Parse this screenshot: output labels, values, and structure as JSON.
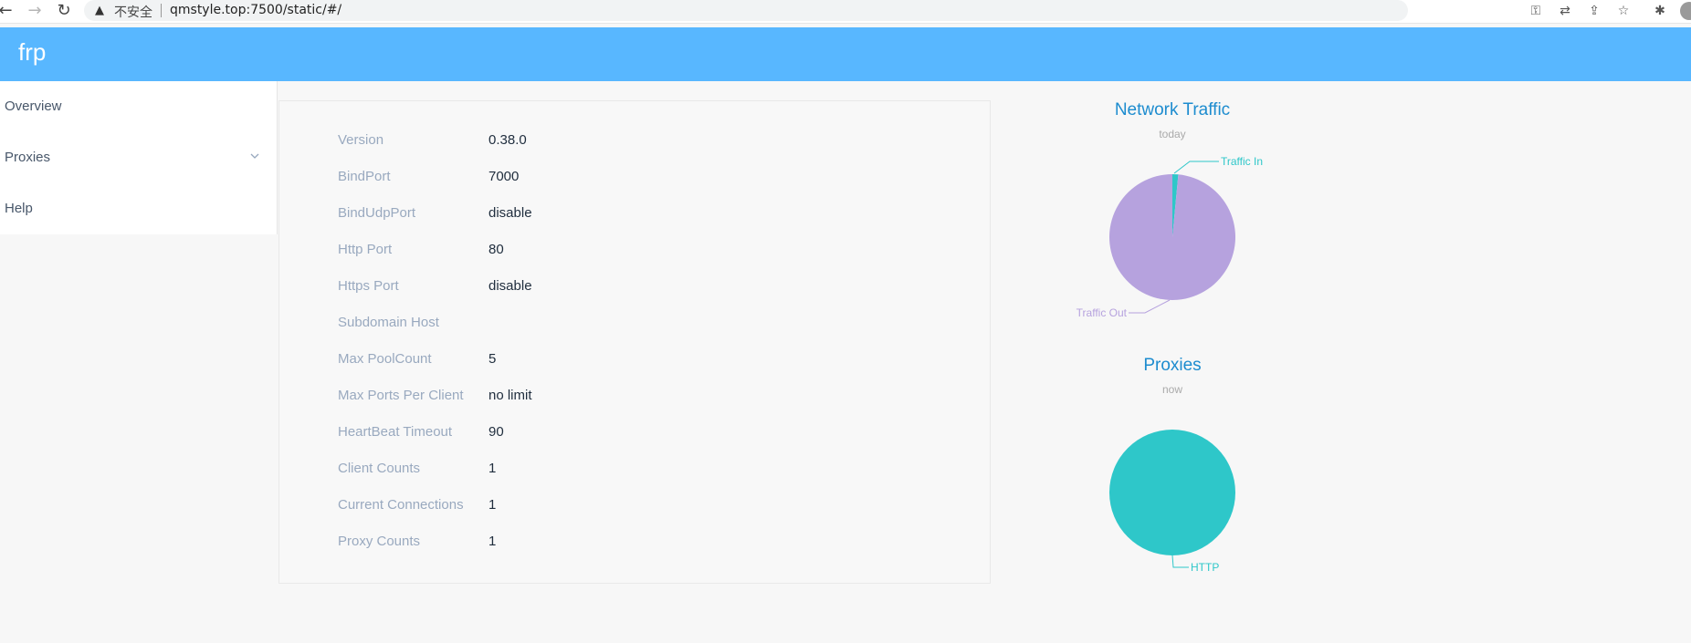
{
  "browser": {
    "back_icon": "←",
    "forward_icon": "→",
    "reload_icon": "↻",
    "warning_icon": "▲",
    "security_text": "不安全",
    "url": "qmstyle.top:7500/static/#/",
    "key_icon": "⚿",
    "translate_icon": "⇄",
    "share_icon": "⇪",
    "bookmark_icon": "☆",
    "extensions_icon": "✱"
  },
  "header": {
    "title": "frp",
    "color": "#58b7ff"
  },
  "sidebar": {
    "items": [
      {
        "label": "Overview"
      },
      {
        "label": "Proxies",
        "has_submenu": true
      },
      {
        "label": "Help"
      }
    ]
  },
  "server_info": {
    "rows": [
      {
        "label": "Version",
        "value": "0.38.0"
      },
      {
        "label": "BindPort",
        "value": "7000"
      },
      {
        "label": "BindUdpPort",
        "value": "disable"
      },
      {
        "label": "Http Port",
        "value": "80"
      },
      {
        "label": "Https Port",
        "value": "disable"
      },
      {
        "label": "Subdomain Host",
        "value": ""
      },
      {
        "label": "Max PoolCount",
        "value": "5"
      },
      {
        "label": "Max Ports Per Client",
        "value": "no limit"
      },
      {
        "label": "HeartBeat Timeout",
        "value": "90"
      },
      {
        "label": "Client Counts",
        "value": "1"
      },
      {
        "label": "Current Connections",
        "value": "1"
      },
      {
        "label": "Proxy Counts",
        "value": "1"
      }
    ]
  },
  "charts": {
    "traffic": {
      "title": "Network Traffic",
      "subtitle": "today"
    },
    "proxies": {
      "title": "Proxies",
      "subtitle": "now"
    }
  },
  "chart_data": [
    {
      "type": "pie",
      "title": "Network Traffic",
      "subtitle": "today",
      "slices": [
        {
          "name": "Traffic In",
          "value": 1.5,
          "color": "#2ec7c9"
        },
        {
          "name": "Traffic Out",
          "value": 98.5,
          "color": "#b6a2de"
        }
      ]
    },
    {
      "type": "pie",
      "title": "Proxies",
      "subtitle": "now",
      "slices": [
        {
          "name": "HTTP",
          "value": 1,
          "color": "#2ec7c9"
        }
      ]
    }
  ]
}
